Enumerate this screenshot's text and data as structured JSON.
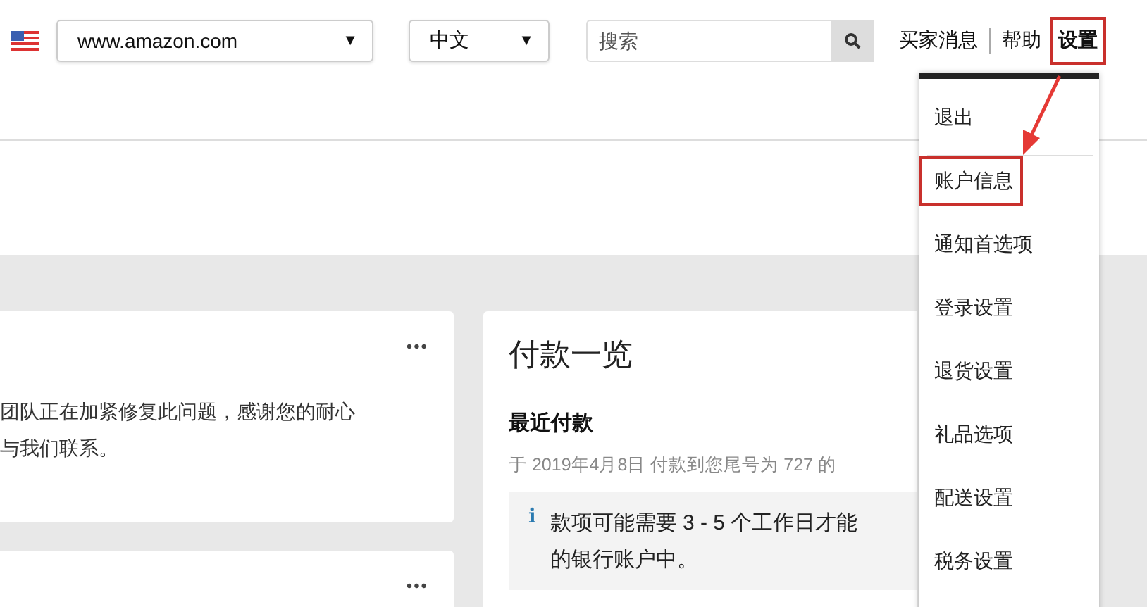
{
  "header": {
    "marketplace": {
      "value": "www.amazon.com",
      "caret": "▼"
    },
    "language": {
      "value": "中文",
      "caret": "▼"
    },
    "search": {
      "placeholder": "搜索"
    },
    "links": [
      {
        "label": "买家消息",
        "highlighted": false
      },
      {
        "label": "帮助",
        "highlighted": false
      },
      {
        "label": "设置",
        "highlighted": true
      }
    ]
  },
  "cards": [
    {
      "menu": "•••",
      "lines": [
        "团队正在加紧修复此问题，感谢您的耐心",
        "与我们联系。"
      ]
    },
    {
      "menu": "•••"
    }
  ],
  "payments": {
    "title": "付款一览",
    "subtitle": "最近付款",
    "date_line": "于 2019年4月8日 付款到您尾号为 727 的",
    "notice": {
      "icon": "i",
      "lines": [
        "款项可能需要 3 - 5 个工作日才能",
        "的银行账户中。"
      ]
    }
  },
  "settings_menu": {
    "items": [
      {
        "label": "退出",
        "highlighted": false
      },
      {
        "label": "账户信息",
        "highlighted": true
      },
      {
        "label": "通知首选项",
        "highlighted": false
      },
      {
        "label": "登录设置",
        "highlighted": false
      },
      {
        "label": "退货设置",
        "highlighted": false
      },
      {
        "label": "礼品选项",
        "highlighted": false
      },
      {
        "label": "配送设置",
        "highlighted": false
      },
      {
        "label": "税务设置",
        "highlighted": false
      }
    ]
  }
}
